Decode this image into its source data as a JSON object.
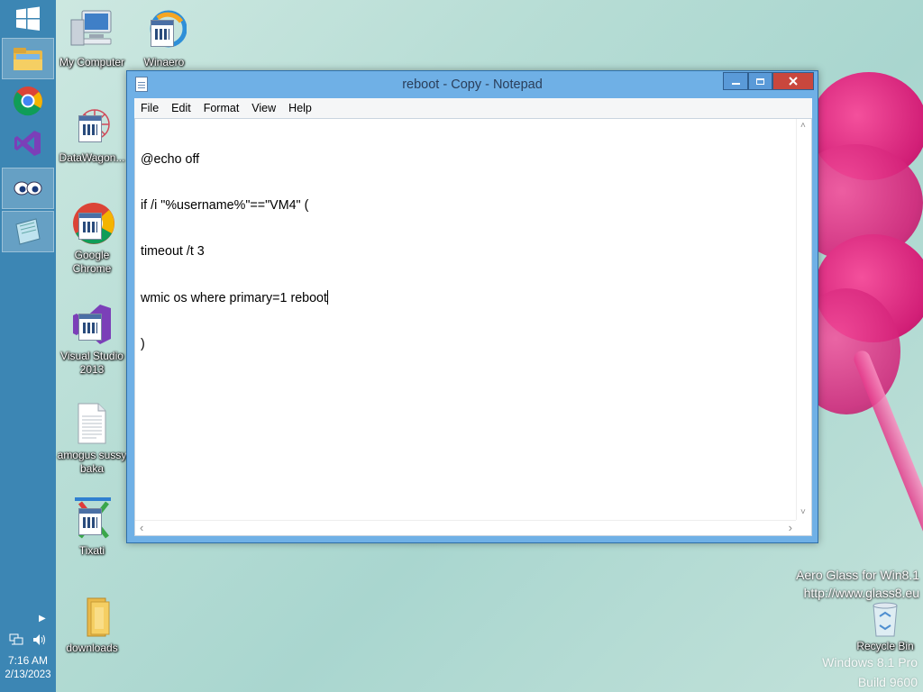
{
  "taskbar": {
    "start_icon": "windows-logo-icon",
    "pinned": [
      {
        "name": "file-explorer-icon"
      },
      {
        "name": "chrome-icon"
      },
      {
        "name": "visual-studio-icon"
      },
      {
        "name": "eyes-app-icon"
      },
      {
        "name": "notepad-icon"
      }
    ],
    "tray": {
      "network_icon": "network-icon",
      "volume_icon": "volume-icon"
    },
    "time": "7:16 AM",
    "date": "2/13/2023"
  },
  "desktop": {
    "icons": [
      {
        "label": "My Computer",
        "icon": "computer-icon"
      },
      {
        "label": "Winaero",
        "icon": "winaero-shortcut-icon"
      },
      {
        "label": "DataWagon...",
        "icon": "datawagon-shortcut-icon"
      },
      {
        "label": "Google Chrome",
        "icon": "chrome-shortcut-icon"
      },
      {
        "label": "Visual Studio 2013",
        "icon": "visual-studio-shortcut-icon"
      },
      {
        "label": "amogus sussy baka",
        "icon": "text-file-icon"
      },
      {
        "label": "Tixati",
        "icon": "tixati-shortcut-icon"
      },
      {
        "label": "downloads",
        "icon": "folder-icon"
      },
      {
        "label": "Recycle Bin",
        "icon": "recycle-bin-icon"
      }
    ],
    "watermark": {
      "line1": "Aero Glass for Win8.1",
      "line2": "http://www.glass8.eu"
    },
    "version": {
      "line1": "Windows 8.1 Pro",
      "line2": "Build 9600"
    }
  },
  "notepad": {
    "title": "reboot - Copy - Notepad",
    "menu": [
      "File",
      "Edit",
      "Format",
      "View",
      "Help"
    ],
    "lines": [
      "@echo off",
      "if /i \"%username%\"==\"VM4\" (",
      "timeout /t 3",
      "wmic os where primary=1 reboot",
      ")"
    ]
  },
  "colors": {
    "taskbar": "#3c86b4",
    "window_frame": "#6fb0e6",
    "close_button": "#c9473d"
  }
}
